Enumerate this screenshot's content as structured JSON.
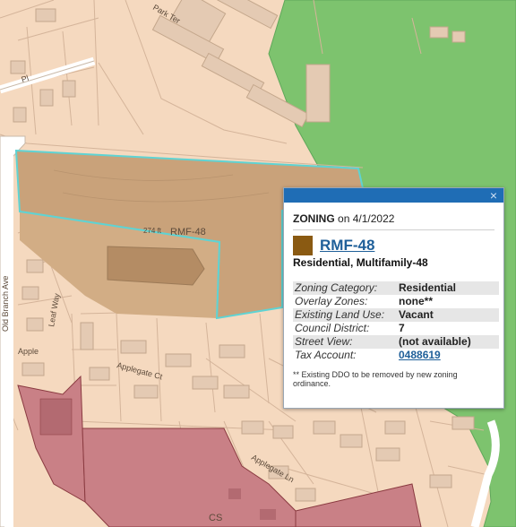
{
  "map": {
    "labels": {
      "parcel_zone": "RMF-48",
      "elevation": "274 ft",
      "street_old_branch": "Old Branch Ave",
      "street_applegate_ct": "Applegate Ct",
      "street_applegate_ln": "Applegate Ln",
      "street_apple": "Apple",
      "street_leaf_way": "Leaf Way",
      "zone_cs": "CS",
      "street_park_ter": "Park Ter",
      "street_pl": "Pl"
    },
    "colors": {
      "residential_background": "#f5d9bf",
      "parcel_line": "#d4b49a",
      "park_green": "#7dc36e",
      "selected_parcel_fill": "#c9a27a",
      "selected_outline": "#5fd3d3",
      "commercial_fill": "#c98086",
      "commercial_line": "#8a3a40"
    }
  },
  "popup": {
    "title": "ZONING",
    "date_prefix": "on",
    "date": "4/1/2022",
    "close_icon": "×",
    "zone_code": "RMF-48",
    "zone_color": "#8a5a12",
    "zone_description": "Residential, Multifamily-48",
    "attributes": [
      {
        "label": "Zoning Category:",
        "value": "Residential"
      },
      {
        "label": "Overlay Zones:",
        "value": "none**"
      },
      {
        "label": "Existing Land Use:",
        "value": "Vacant"
      },
      {
        "label": "Council District:",
        "value": "7"
      },
      {
        "label": "Street View:",
        "value": "(not available)"
      },
      {
        "label": "Tax Account:",
        "value": "0488619"
      }
    ],
    "footnote": "** Existing DDO to be removed by new zoning ordinance."
  }
}
